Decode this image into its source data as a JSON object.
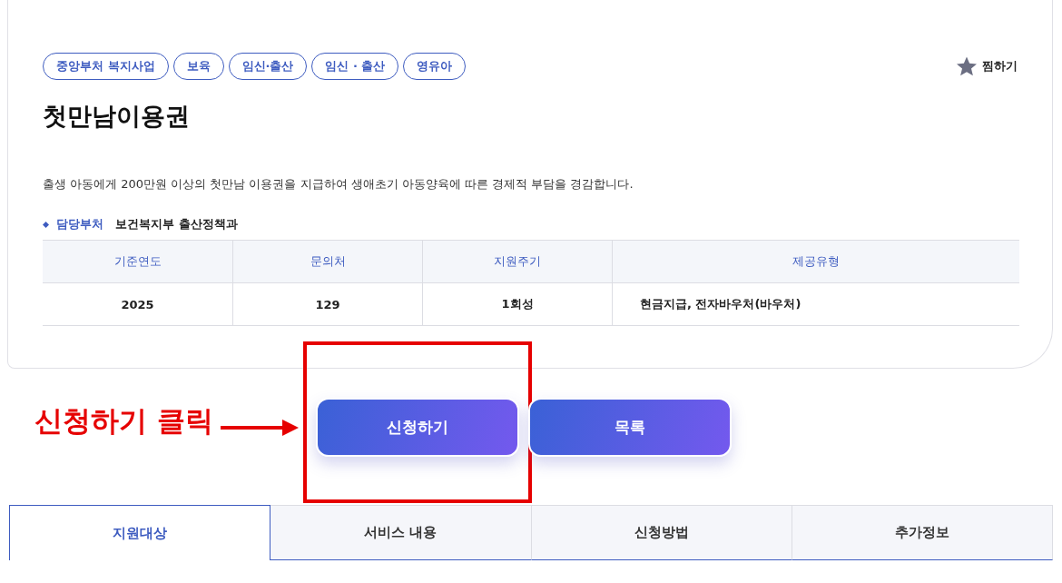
{
  "tags": [
    "중앙부처 복지사업",
    "보육",
    "임신·출산",
    "임신 · 출산",
    "영유아"
  ],
  "favorite": {
    "label": "찜하기",
    "on": false
  },
  "title": "첫만남이용권",
  "description": "출생 아동에게 200만원 이상의 첫만남 이용권을 지급하여 생애초기 아동양육에 따른 경제적 부담을 경감합니다.",
  "department": {
    "label": "담당부처",
    "value": "보건복지부 출산정책과"
  },
  "table": {
    "columns": [
      "기준연도",
      "문의처",
      "지원주기",
      "제공유형"
    ],
    "rows": [
      [
        "2025",
        "129",
        "1회성",
        "현금지급, 전자바우처(바우처)"
      ]
    ]
  },
  "annotation": {
    "text": "신청하기 클릭"
  },
  "buttons": [
    "신청하기",
    "목록"
  ],
  "tabs": [
    {
      "label": "지원대상",
      "selected": true
    },
    {
      "label": "서비스 내용",
      "selected": false
    },
    {
      "label": "신청방법",
      "selected": false
    },
    {
      "label": "추가정보",
      "selected": false
    }
  ]
}
